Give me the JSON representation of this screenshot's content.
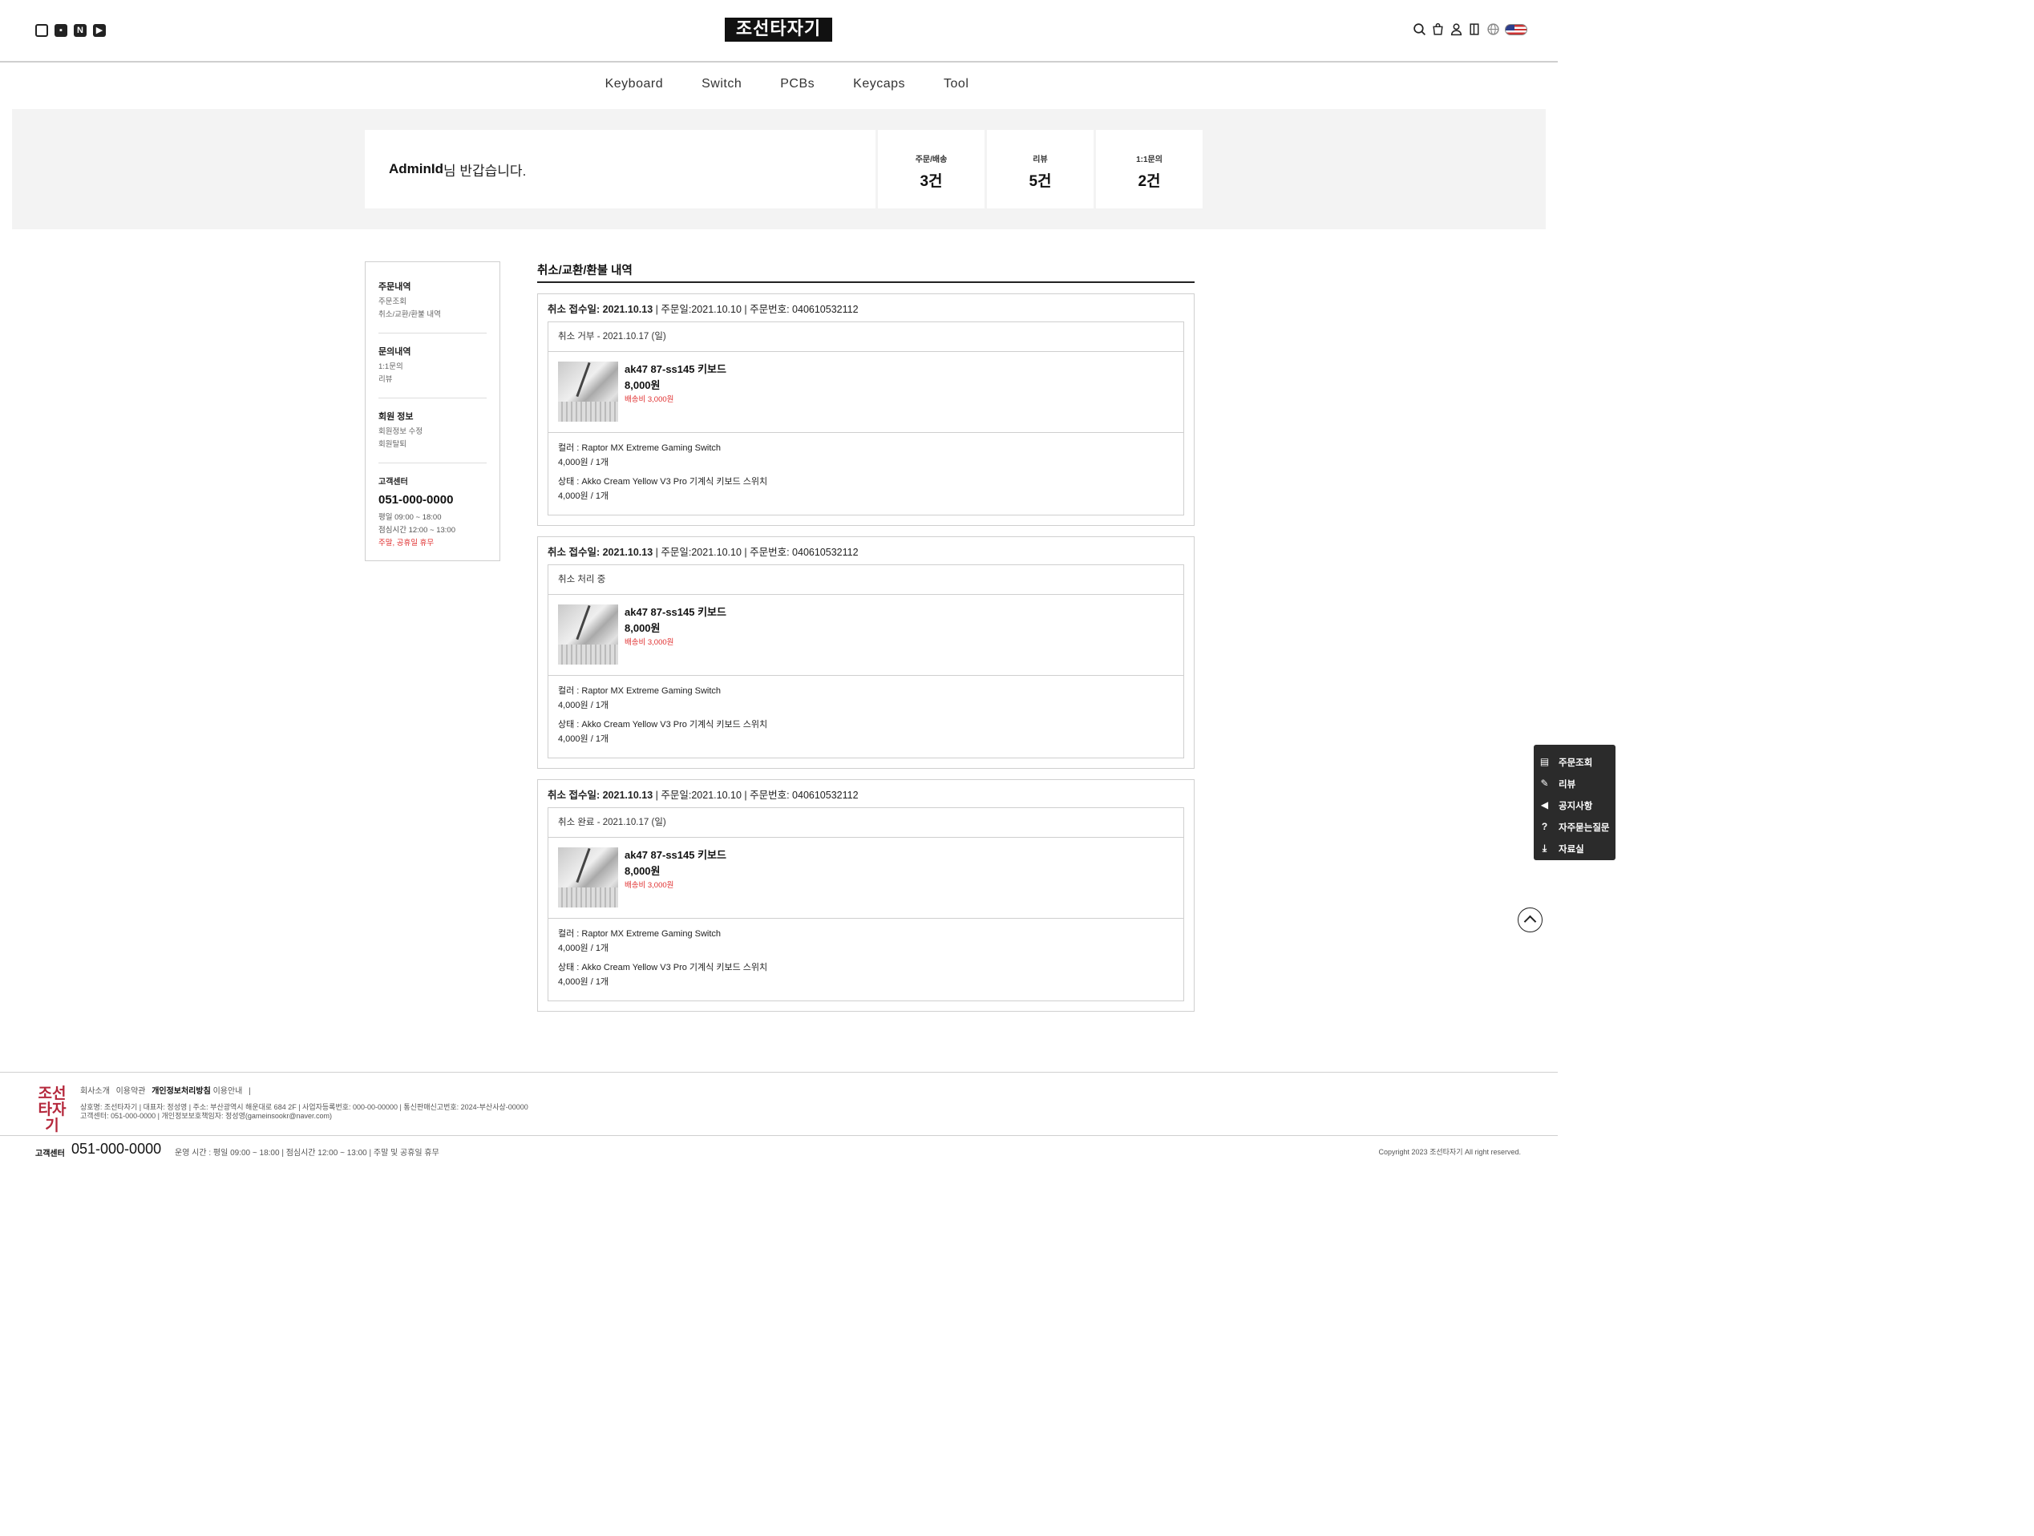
{
  "header": {
    "logo": "조선타자기",
    "social": [
      "instagram-icon",
      "blog-icon",
      "naver-icon",
      "youtube-icon"
    ],
    "utility": [
      "search-icon",
      "cart-icon",
      "user-icon",
      "login-icon",
      "globe-icon",
      "us-flag-icon"
    ]
  },
  "nav": [
    "Keyboard",
    "Switch",
    "PCBs",
    "Keycaps",
    "Tool"
  ],
  "summary": {
    "user": "AdminId",
    "greeting": "님 반갑습니다.",
    "stats": [
      {
        "label": "주문/배송",
        "value": "3건"
      },
      {
        "label": "리뷰",
        "value": "5건"
      },
      {
        "label": "1:1문의",
        "value": "2건"
      }
    ]
  },
  "sidebar": {
    "sections": [
      {
        "title": "주문내역",
        "links": [
          "주문조회",
          "취소/교환/환불 내역"
        ]
      },
      {
        "title": "문의내역",
        "links": [
          "1:1문의",
          "리뷰"
        ]
      },
      {
        "title": "회원 정보",
        "links": [
          "회원정보 수정",
          "회원탈퇴"
        ]
      }
    ],
    "cs": {
      "title": "고객센터",
      "tel": "051-000-0000",
      "hours": [
        "평일 09:00 ~ 18:00",
        "점심시간 12:00 ~ 13:00"
      ],
      "closed": "주말, 공휴일 휴무"
    }
  },
  "content": {
    "title": "취소/교환/환불 내역",
    "orders": [
      {
        "head_bold": "취소 접수일: 2021.10.13",
        "head_rest": " | 주문일:2021.10.10 | 주문번호: 040610532112",
        "status": "취소 거부 -  2021.10.17 (일)",
        "product": {
          "name": "ak47 87-ss145 키보드",
          "price": "8,000원",
          "shipping": "배송비 3,000원"
        },
        "options": [
          {
            "label": "컬러 : Raptor MX Extreme Gaming Switch",
            "value": "4,000원 / 1개"
          },
          {
            "label": "상태 : Akko Cream Yellow V3 Pro 기계식 키보드 스위치",
            "value": "4,000원 / 1개"
          }
        ]
      },
      {
        "head_bold": "취소 접수일: 2021.10.13",
        "head_rest": " | 주문일:2021.10.10 | 주문번호: 040610532112",
        "status": "취소 처리 중",
        "product": {
          "name": "ak47 87-ss145 키보드",
          "price": "8,000원",
          "shipping": "배송비 3,000원"
        },
        "options": [
          {
            "label": "컬러 : Raptor MX Extreme Gaming Switch",
            "value": "4,000원 / 1개"
          },
          {
            "label": "상태 : Akko Cream Yellow V3 Pro 기계식 키보드 스위치",
            "value": "4,000원 / 1개"
          }
        ]
      },
      {
        "head_bold": "취소 접수일: 2021.10.13",
        "head_rest": " | 주문일:2021.10.10 | 주문번호: 040610532112",
        "status": "취소 완료 -  2021.10.17 (일)",
        "product": {
          "name": "ak47 87-ss145 키보드",
          "price": "8,000원",
          "shipping": "배송비 3,000원"
        },
        "options": [
          {
            "label": "컬러 : Raptor MX Extreme Gaming Switch",
            "value": "4,000원 / 1개"
          },
          {
            "label": "상태 : Akko Cream Yellow V3 Pro 기계식 키보드 스위치",
            "value": "4,000원 / 1개"
          }
        ]
      }
    ]
  },
  "quick_menu": [
    {
      "icon": "receipt-icon",
      "label": "주문조회"
    },
    {
      "icon": "review-icon",
      "label": "리뷰"
    },
    {
      "icon": "megaphone-icon",
      "label": "공지사항"
    },
    {
      "icon": "question-icon",
      "label": "자주묻는질문"
    },
    {
      "icon": "download-icon",
      "label": "자료실"
    }
  ],
  "footer": {
    "logo": "조선타자기",
    "links": [
      "회사소개",
      "이용약관",
      "개인정보처리방침",
      "이용안내",
      "|"
    ],
    "info_line1": "상호명: 조선타자기 | 대표자: 정성영 | 주소: 부산광역시 해운대로 684 2F | 사업자등록번호: 000-00-00000 | 통신판매신고번호: 2024-부산사상-00000",
    "info_line2": "고객센터: 051-000-0000 | 개인정보보호책임자: 정성영(gameinsookr@naver.com)",
    "cs_label": "고객센터",
    "cs_tel": "051-000-0000",
    "cs_hours": "운영 시간 : 평일 09:00 ~ 18:00  |  점심시간 12:00 ~ 13:00  |  주말 및 공휴일 휴무",
    "copyright": "Copyright 2023 조선타자기 All right reserved."
  }
}
